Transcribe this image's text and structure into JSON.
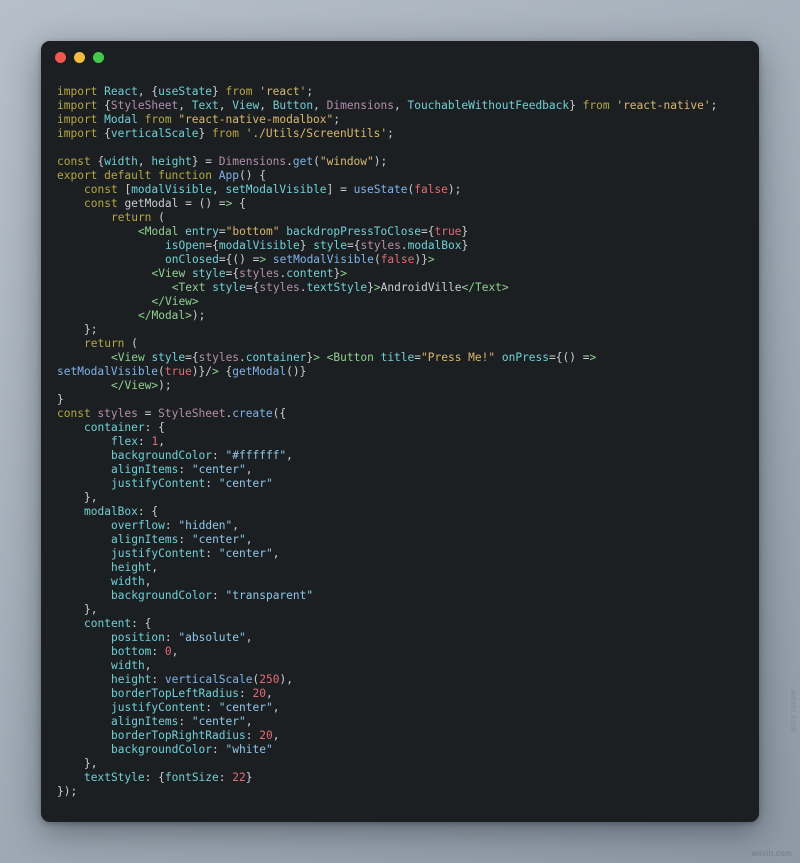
{
  "window": {
    "traffic_lights": [
      {
        "name": "close",
        "color": "#f0584f"
      },
      {
        "name": "minimize",
        "color": "#f5bc41"
      },
      {
        "name": "maximize",
        "color": "#45c94a"
      }
    ],
    "background": "#1c1f22"
  },
  "desktop": {
    "background_top": "#b6bfc9",
    "background_bottom": "#8e99a6"
  },
  "theme": {
    "keyword": "#b5a642",
    "variable": "#6fd0d6",
    "string_import": "#d9b86c",
    "string_value": "#8ec7e8",
    "class_name": "#b48ead",
    "function": "#7fb3e8",
    "jsx_tag": "#8fcf8f",
    "literal": "#e06c75",
    "plain": "#c8cdd2"
  },
  "watermarks": {
    "bottom_right": "woxin.com",
    "side": "woxin.com"
  },
  "editor": {
    "language": "javascript",
    "filename_hint": "App.js",
    "lines": [
      "import React, {useState} from 'react';",
      "import {StyleSheet, Text, View, Button, Dimensions, TouchableWithoutFeedback} from 'react-native';",
      "import Modal from \"react-native-modalbox\";",
      "import {verticalScale} from './Utils/ScreenUtils';",
      "",
      "const {width, height} = Dimensions.get(\"window\");",
      "export default function App() {",
      "    const [modalVisible, setModalVisible] = useState(false);",
      "    const getModal = () => {",
      "        return (",
      "            <Modal entry=\"bottom\" backdropPressToClose={true}",
      "                isOpen={modalVisible} style={styles.modalBox}",
      "                onClosed={() => setModalVisible(false)}>",
      "              <View style={styles.content}>",
      "                 <Text style={styles.textStyle}>AndroidVille</Text>",
      "              </View>",
      "            </Modal>);",
      "    };",
      "    return (",
      "        <View style={styles.container}> <Button title=\"Press Me!\" onPress={() =>",
      "setModalVisible(true)}/> {getModal()}",
      "        </View>);",
      "}",
      "const styles = StyleSheet.create({",
      "    container: {",
      "        flex: 1,",
      "        backgroundColor: \"#ffffff\",",
      "        alignItems: \"center\",",
      "        justifyContent: \"center\"",
      "    },",
      "    modalBox: {",
      "        overflow: \"hidden\",",
      "        alignItems: \"center\",",
      "        justifyContent: \"center\",",
      "        height,",
      "        width,",
      "        backgroundColor: \"transparent\"",
      "    },",
      "    content: {",
      "        position: \"absolute\",",
      "        bottom: 0,",
      "        width,",
      "        height: verticalScale(250),",
      "        borderTopLeftRadius: 20,",
      "        justifyContent: \"center\",",
      "        alignItems: \"center\",",
      "        borderTopRightRadius: 20,",
      "        backgroundColor: \"white\"",
      "    },",
      "    textStyle: {fontSize: 22}",
      "});"
    ]
  }
}
